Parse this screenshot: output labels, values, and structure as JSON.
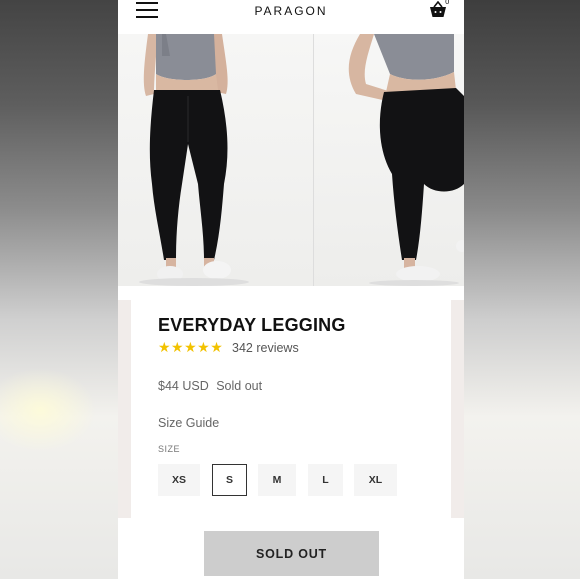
{
  "header": {
    "brand": "PARAGON",
    "cart_count": "0",
    "menu_icon": "hamburger-icon",
    "cart_icon": "cart-icon"
  },
  "product": {
    "title": "EVERYDAY LEGGING",
    "stars": "★★★★★",
    "rating": 5,
    "review_count": "342 reviews",
    "price": "$44 USD",
    "availability": "Sold out",
    "size_guide_label": "Size Guide",
    "size_label": "SIZE",
    "sizes": [
      "XS",
      "S",
      "M",
      "L",
      "XL"
    ],
    "selected_size": "S",
    "cta_label": "SOLD OUT"
  },
  "colors": {
    "star": "#f2c200",
    "button_disabled": "#cdcdcd",
    "card_backdrop": "#f1ecea"
  }
}
